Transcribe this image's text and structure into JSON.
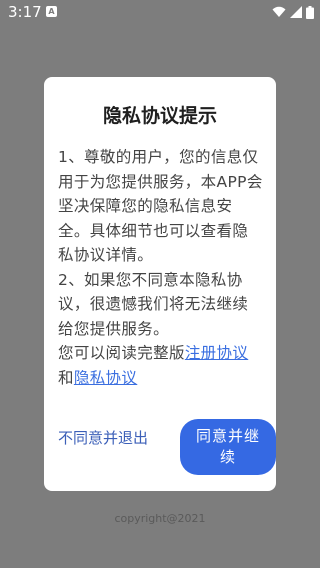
{
  "status_bar": {
    "time": "3:17",
    "notification_icon": "a-box-icon",
    "icons": [
      "wifi-icon",
      "signal-icon",
      "battery-icon"
    ]
  },
  "dialog": {
    "title": "隐私协议提示",
    "paragraph_1": "1、尊敬的用户，您的信息仅用于为您提供服务，本APP会坚决保障您的隐私信息安全。具体细节也可以查看隐私协议详情。",
    "paragraph_2": "2、如果您不同意本隐私协议，很遗憾我们将无法继续给您提供服务。",
    "read_prefix": "您可以阅读完整版",
    "register_link": "注册协议",
    "and_text": "和",
    "privacy_link": "隐私协议",
    "decline_label": "不同意并退出",
    "agree_label": "同意并继续"
  },
  "footer": {
    "copyright": "copyright@2021"
  },
  "colors": {
    "overlay": "#7d7d7d",
    "primary": "#3569e3",
    "link": "#3b6fe0"
  }
}
